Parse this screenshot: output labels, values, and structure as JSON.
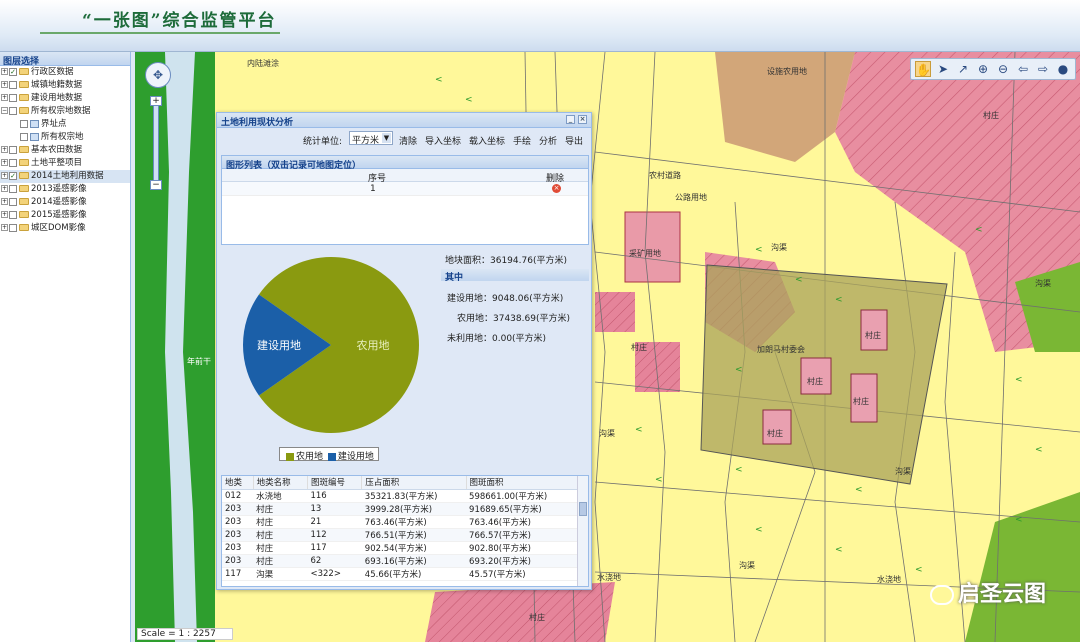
{
  "header": {
    "title": "“一张图”综合监管平台"
  },
  "tree": {
    "title": "图层选择",
    "items": [
      {
        "label": "行政区数据",
        "checked": true,
        "expanded": false,
        "level": 0,
        "type": "folder"
      },
      {
        "label": "城镇地籍数据",
        "checked": false,
        "expanded": false,
        "level": 0,
        "type": "folder"
      },
      {
        "label": "建设用地数据",
        "checked": false,
        "expanded": false,
        "level": 0,
        "type": "folder"
      },
      {
        "label": "所有权宗地数据",
        "checked": false,
        "expanded": true,
        "level": 0,
        "type": "folder"
      },
      {
        "label": "界址点",
        "checked": false,
        "level": 1,
        "type": "leaf"
      },
      {
        "label": "所有权宗地",
        "checked": false,
        "level": 1,
        "type": "leaf"
      },
      {
        "label": "基本农田数据",
        "checked": false,
        "expanded": false,
        "level": 0,
        "type": "folder"
      },
      {
        "label": "土地平整项目",
        "checked": false,
        "expanded": false,
        "level": 0,
        "type": "folder"
      },
      {
        "label": "2014土地利用数据",
        "checked": true,
        "expanded": false,
        "level": 0,
        "type": "folder",
        "selected": true
      },
      {
        "label": "2013遥感影像",
        "checked": false,
        "expanded": false,
        "level": 0,
        "type": "folder"
      },
      {
        "label": "2014遥感影像",
        "checked": false,
        "expanded": false,
        "level": 0,
        "type": "folder"
      },
      {
        "label": "2015遥感影像",
        "checked": false,
        "expanded": false,
        "level": 0,
        "type": "folder"
      },
      {
        "label": "城区DOM影像",
        "checked": false,
        "expanded": false,
        "level": 0,
        "type": "folder"
      }
    ]
  },
  "map": {
    "labels": {
      "l1": "内陆滩涂",
      "l2": "设施农用地",
      "l3": "村庄",
      "l4": "采矿用地",
      "l5": "加朗马村委会",
      "l6": "村庄",
      "l7": "村庄",
      "l8": "村庄",
      "l9": "村庄",
      "l10": "村庄",
      "l11": "村庄",
      "l12": "水浇地",
      "l13": "水浇地",
      "l14": "年前干",
      "l15": "农村道路",
      "l16": "公路用地",
      "l17": "沟渠",
      "l18": "沟渠",
      "l19": "沟渠",
      "l20": "沟渠",
      "l21": "沟渠"
    },
    "scale": "Scale = 1 : 2257",
    "watermark": "启圣云图"
  },
  "dialog": {
    "title": "土地利用现状分析",
    "toolbar": {
      "unit_label": "统计单位:",
      "unit_value": "平方米",
      "clear": "清除",
      "import": "导入坐标",
      "load": "载入坐标",
      "draw": "手绘",
      "analyze": "分析",
      "export": "导出"
    },
    "shape_list_title": "图形列表（双击记录可地图定位）",
    "shape_list": {
      "col_index": "序号",
      "col_delete": "删除",
      "rows": [
        {
          "index": "1"
        }
      ]
    },
    "stats": {
      "total": "地块面积：36194.76(平方米)",
      "sub_header": "其中",
      "construction": "建设用地：9048.06(平方米)",
      "farm": "农用地：37438.69(平方米)",
      "unused": "未利用地：0.00(平方米)"
    },
    "legend": {
      "farm": "农用地",
      "construction": "建设用地"
    },
    "table": {
      "headers": [
        "地类",
        "地类名称",
        "图斑编号",
        "压占面积",
        "图斑面积"
      ],
      "rows": [
        [
          "012",
          "水浇地",
          "116",
          "35321.83(平方米)",
          "598661.00(平方米)"
        ],
        [
          "203",
          "村庄",
          "13",
          "3999.28(平方米)",
          "91689.65(平方米)"
        ],
        [
          "203",
          "村庄",
          "21",
          "763.46(平方米)",
          "763.46(平方米)"
        ],
        [
          "203",
          "村庄",
          "112",
          "766.51(平方米)",
          "766.57(平方米)"
        ],
        [
          "203",
          "村庄",
          "117",
          "902.54(平方米)",
          "902.80(平方米)"
        ],
        [
          "203",
          "村庄",
          "62",
          "693.16(平方米)",
          "693.20(平方米)"
        ],
        [
          "117",
          "沟渠",
          "<322>",
          "45.66(平方米)",
          "45.57(平方米)"
        ]
      ]
    }
  },
  "chart_data": {
    "type": "pie",
    "labels": [
      "农用地",
      "建设用地"
    ],
    "values": [
      37438.69,
      9048.06
    ],
    "colors": [
      "#8a9a10",
      "#1b5fa8"
    ]
  }
}
